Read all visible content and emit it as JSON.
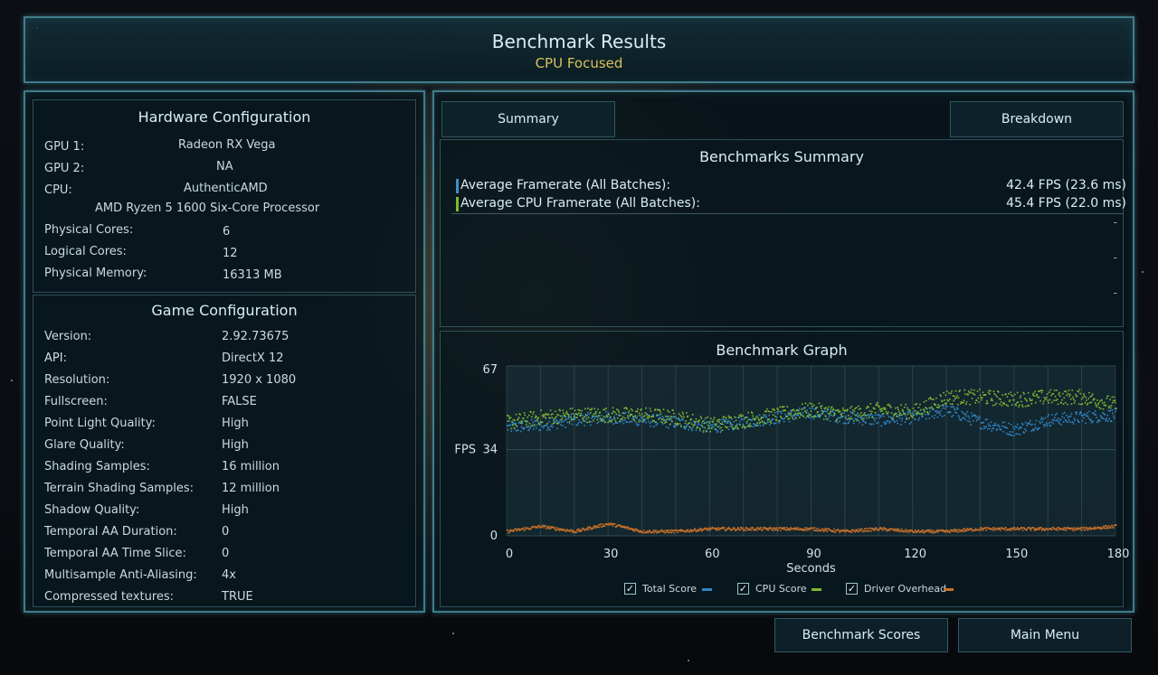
{
  "header": {
    "title": "Benchmark Results",
    "subtitle": "CPU Focused"
  },
  "hardware": {
    "title": "Hardware Configuration",
    "rows": [
      {
        "label": "GPU 1:",
        "value": "Radeon RX Vega"
      },
      {
        "label": "GPU 2:",
        "value": "NA"
      },
      {
        "label": "CPU:",
        "value": "AuthenticAMD"
      },
      {
        "label": "",
        "value": "AMD Ryzen 5 1600 Six-Core Processor"
      },
      {
        "label": "Physical Cores:",
        "value": "6"
      },
      {
        "label": "Logical Cores:",
        "value": "12"
      },
      {
        "label": "Physical Memory:",
        "value": "16313  MB"
      }
    ]
  },
  "game": {
    "title": "Game Configuration",
    "rows": [
      {
        "label": "Version:",
        "value": "2.92.73675"
      },
      {
        "label": "API:",
        "value": "DirectX 12"
      },
      {
        "label": "Resolution:",
        "value": "1920 x 1080"
      },
      {
        "label": "Fullscreen:",
        "value": "FALSE"
      },
      {
        "label": "Point Light Quality:",
        "value": "High"
      },
      {
        "label": "Glare Quality:",
        "value": "High"
      },
      {
        "label": "Shading Samples:",
        "value": "16 million"
      },
      {
        "label": "Terrain Shading Samples:",
        "value": "12 million"
      },
      {
        "label": "Shadow Quality:",
        "value": "High"
      },
      {
        "label": "Temporal AA Duration:",
        "value": "0"
      },
      {
        "label": "Temporal AA Time Slice:",
        "value": "0"
      },
      {
        "label": "Multisample Anti-Aliasing:",
        "value": "4x"
      },
      {
        "label": "Compressed textures:",
        "value": "TRUE"
      }
    ]
  },
  "tabs": {
    "summary": "Summary",
    "breakdown": "Breakdown"
  },
  "summary": {
    "title": "Benchmarks Summary",
    "rows": [
      {
        "label": "Average Framerate (All Batches):",
        "value": "42.4 FPS (23.6 ms)",
        "color": "#3d8fc4"
      },
      {
        "label": "Average CPU Framerate (All Batches):",
        "value": "45.4 FPS (22.0 ms)",
        "color": "#7fb832"
      }
    ],
    "dashes": [
      "-",
      "-",
      "-"
    ]
  },
  "graph": {
    "title": "Benchmark Graph",
    "ylabel": "FPS",
    "xlabel": "Seconds",
    "legend": [
      {
        "label": "Total Score",
        "color": "#2f86c4",
        "checked": "✓"
      },
      {
        "label": "CPU Score",
        "color": "#7fb832",
        "checked": "✓"
      },
      {
        "label": "Driver Overhead",
        "color": "#c8702a",
        "checked": "✓"
      }
    ]
  },
  "chart_data": {
    "type": "scatter",
    "title": "Benchmark Graph",
    "xlabel": "Seconds",
    "ylabel": "FPS",
    "xlim": [
      0,
      180
    ],
    "ylim": [
      0,
      67
    ],
    "xticks": [
      "0",
      "30",
      "60",
      "90",
      "120",
      "150",
      "180"
    ],
    "yticks": [
      "0",
      "34",
      "67"
    ],
    "grid": true,
    "legend_position": "bottom",
    "x": [
      0,
      10,
      20,
      30,
      40,
      50,
      60,
      70,
      80,
      90,
      100,
      110,
      120,
      130,
      140,
      150,
      160,
      170,
      180
    ],
    "series": [
      {
        "name": "Total Score",
        "color": "#2f86c4",
        "values": [
          43,
          44,
          46,
          47,
          46,
          45,
          43,
          45,
          47,
          49,
          47,
          46,
          47,
          50,
          45,
          42,
          46,
          47,
          48
        ]
      },
      {
        "name": "CPU Score",
        "color": "#7fb832",
        "values": [
          45,
          47,
          48,
          48,
          48,
          47,
          44,
          46,
          48,
          50,
          48,
          50,
          49,
          55,
          55,
          54,
          55,
          55,
          52
        ]
      },
      {
        "name": "Driver Overhead",
        "color": "#c8702a",
        "values": [
          2,
          4,
          2,
          5,
          2,
          2,
          3,
          3,
          3,
          3,
          2,
          3,
          2,
          2,
          3,
          3,
          3,
          3,
          4
        ]
      }
    ]
  },
  "buttons": {
    "scores": "Benchmark Scores",
    "menu": "Main Menu"
  }
}
